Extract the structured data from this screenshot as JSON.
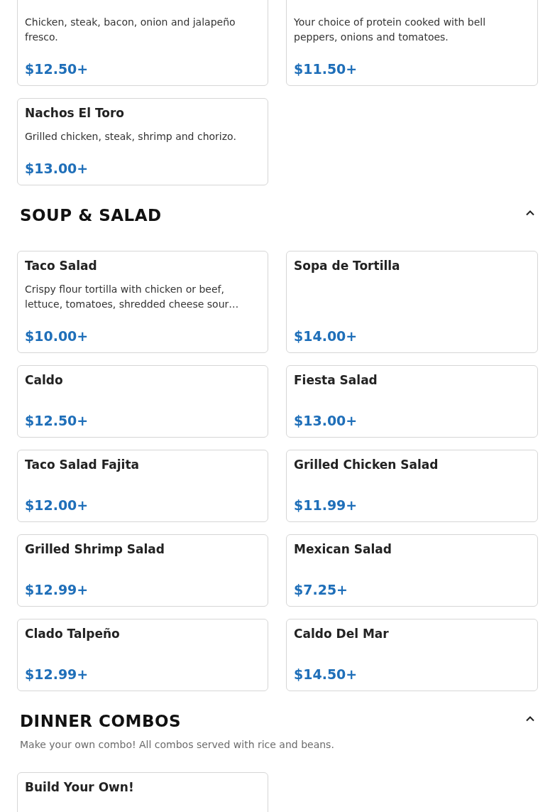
{
  "sections": [
    {
      "items": [
        {
          "description": "Chicken, steak, bacon, onion and jalapeño fresco.",
          "price": "$12.50+"
        },
        {
          "description": "Your choice of protein cooked with bell peppers, onions and tomatoes.",
          "price": "$11.50+"
        },
        {
          "name": "Nachos El Toro",
          "description": "Grilled chicken, steak, shrimp and chorizo.",
          "price": "$13.00+"
        }
      ]
    },
    {
      "title": "SOUP & SALAD",
      "expanded": true,
      "items": [
        {
          "name": "Taco Salad",
          "description": "Crispy flour tortilla with chicken or beef, lettuce, tomatoes, shredded cheese sour…",
          "price": "$10.00+"
        },
        {
          "name": "Sopa de Tortilla",
          "price": "$14.00+"
        },
        {
          "name": "Caldo",
          "price": "$12.50+"
        },
        {
          "name": "Fiesta Salad",
          "price": "$13.00+"
        },
        {
          "name": "Taco Salad Fajita",
          "price": "$12.00+"
        },
        {
          "name": "Grilled Chicken Salad",
          "price": "$11.99+"
        },
        {
          "name": "Grilled Shrimp Salad",
          "price": "$12.99+"
        },
        {
          "name": "Mexican Salad",
          "price": "$7.25+"
        },
        {
          "name": "Clado Talpeño",
          "price": "$12.99+"
        },
        {
          "name": "Caldo Del Mar",
          "price": "$14.50+"
        }
      ]
    },
    {
      "title": "DINNER COMBOS",
      "expanded": true,
      "subtitle": "Make your own combo! All combos served with rice and beans.",
      "items": [
        {
          "name": "Build Your Own!"
        }
      ]
    }
  ]
}
